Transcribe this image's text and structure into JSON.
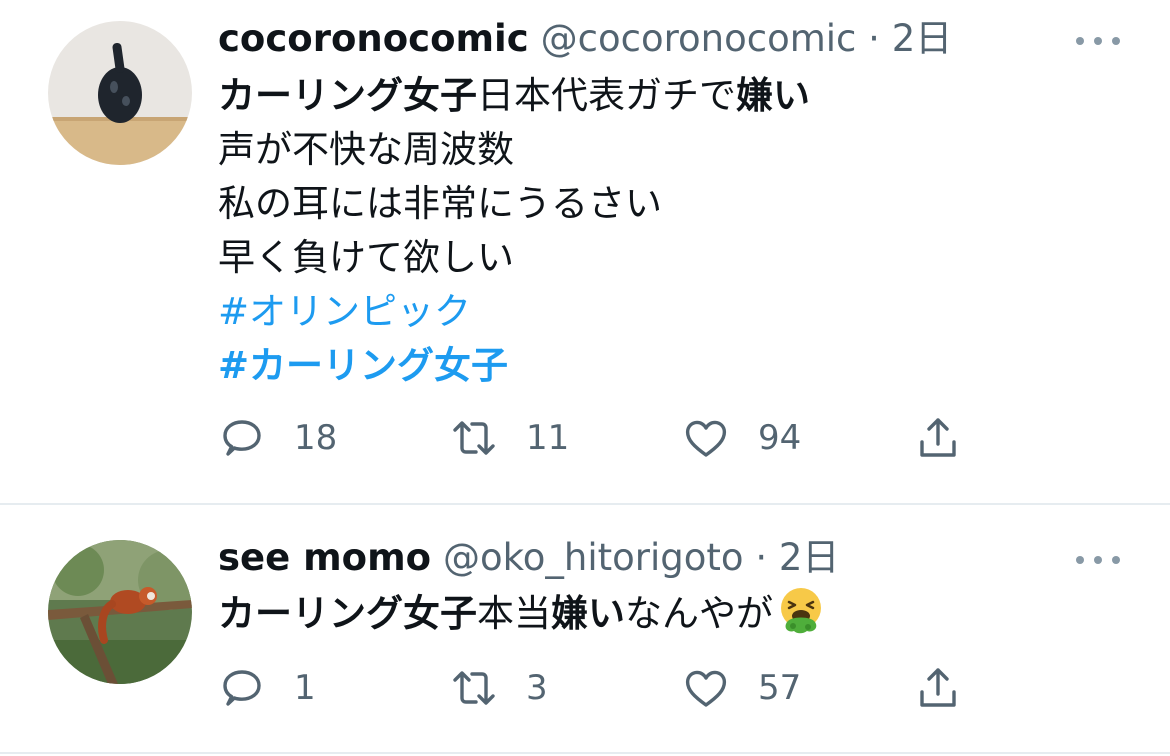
{
  "tweets": [
    {
      "name": "cocoronocomic",
      "handle": "@cocoronocomic",
      "separator": "·",
      "time": "2日",
      "text": {
        "l1_a": "カーリング女子",
        "l1_b": "日本代表ガチで",
        "l1_c": "嫌い",
        "l2": "声が不快な周波数",
        "l3": "私の耳には非常にうるさい",
        "l4": "早く負けて欲しい",
        "hashtag1": "#オリンピック",
        "hashtag2": "#カーリング女子"
      },
      "replies": "18",
      "retweets": "11",
      "likes": "94"
    },
    {
      "name": "see momo",
      "handle": "@oko_hitorigoto",
      "separator": "·",
      "time": "2日",
      "text": {
        "p1": "カーリング女子",
        "p2": "本当",
        "p3": "嫌い",
        "p4": "なんやが"
      },
      "emoji": "nauseated-face-vomiting",
      "replies": "1",
      "retweets": "3",
      "likes": "57"
    }
  ],
  "colors": {
    "hashtag": "#1d9bf0",
    "secondary_text": "#536471",
    "divider": "#e6ecf0"
  }
}
